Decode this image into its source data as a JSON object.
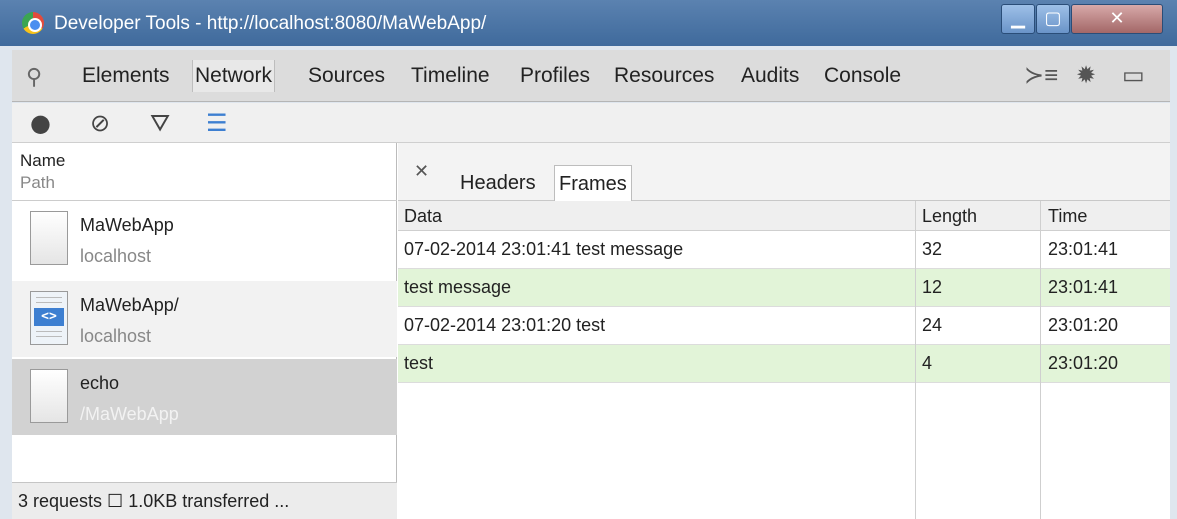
{
  "window": {
    "title": "Developer Tools - http://localhost:8080/MaWebApp/"
  },
  "tabs": [
    "Elements",
    "Network",
    "Sources",
    "Timeline",
    "Profiles",
    "Resources",
    "Audits",
    "Console"
  ],
  "active_tab": "Network",
  "left_header": {
    "name": "Name",
    "path": "Path"
  },
  "requests": [
    {
      "name": "MaWebApp",
      "path": "localhost",
      "icon": "document-icon"
    },
    {
      "name": "MaWebApp/",
      "path": "localhost",
      "icon": "html-file-icon"
    },
    {
      "name": "echo",
      "path": "/MaWebApp",
      "icon": "document-icon"
    }
  ],
  "status": {
    "text": "3 requests ☐ 1.0KB transferred ..."
  },
  "detail_tabs": [
    "Headers",
    "Frames"
  ],
  "active_detail_tab": "Frames",
  "frames": {
    "columns": [
      "Data",
      "Length",
      "Time"
    ],
    "rows": [
      {
        "data": "07-02-2014 23:01:41 test message",
        "length": "32",
        "time": "23:01:41",
        "direction": "sent"
      },
      {
        "data": "test message",
        "length": "12",
        "time": "23:01:41",
        "direction": "received"
      },
      {
        "data": "07-02-2014 23:01:20 test",
        "length": "24",
        "time": "23:01:20",
        "direction": "sent"
      },
      {
        "data": "test",
        "length": "4",
        "time": "23:01:20",
        "direction": "received"
      }
    ]
  },
  "colors": {
    "received_row": "#e2f4d8",
    "titlebar": "#4a76a8",
    "selected_request": "#d2d2d2"
  }
}
